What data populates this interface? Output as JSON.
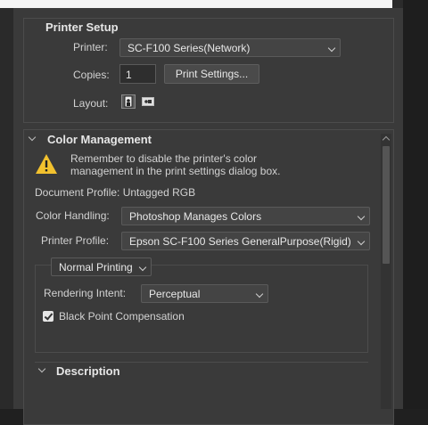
{
  "printer_setup": {
    "header": "Printer Setup",
    "printer_label": "Printer:",
    "printer_value": "SC-F100 Series(Network)",
    "copies_label": "Copies:",
    "copies_value": "1",
    "print_settings_label": "Print Settings...",
    "layout_label": "Layout:"
  },
  "color_management": {
    "header": "Color Management",
    "warning_line1": "Remember to disable the printer's color",
    "warning_line2": "management in the print settings dialog box.",
    "document_profile": "Document Profile: Untagged RGB",
    "color_handling_label": "Color Handling:",
    "color_handling_value": "Photoshop Manages Colors",
    "printer_profile_label": "Printer Profile:",
    "printer_profile_value": "Epson SC-F100 Series GeneralPurpose(Rigid)",
    "normal_printing_value": "Normal Printing",
    "rendering_intent_label": "Rendering Intent:",
    "rendering_intent_value": "Perceptual",
    "black_point_label": "Black Point Compensation",
    "black_point_checked": true
  },
  "description": {
    "header": "Description"
  },
  "icons": {
    "warning": "warning-icon",
    "portrait": "portrait-layout-icon",
    "landscape": "landscape-layout-icon",
    "collapse": "chevron-down-icon"
  },
  "colors": {
    "panel": "#3a3a3a",
    "warning": "#f2c12e"
  }
}
